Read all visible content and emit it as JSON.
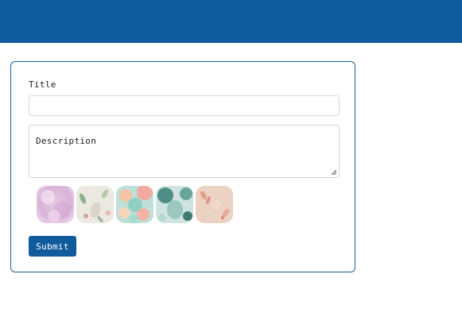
{
  "colors": {
    "header": "#0f5b9b",
    "card_border": "#1c5f9c",
    "button": "#0f5b9b"
  },
  "form": {
    "title_label": "Title",
    "title_value": "",
    "description_placeholder": "Description",
    "submit_label": "Submit"
  },
  "images": [
    {
      "name": "pink-clouds-thumbnail"
    },
    {
      "name": "floral-leaves-thumbnail"
    },
    {
      "name": "pastel-balloons-thumbnail"
    },
    {
      "name": "teal-shapes-thumbnail"
    },
    {
      "name": "peach-floral-thumbnail"
    }
  ]
}
